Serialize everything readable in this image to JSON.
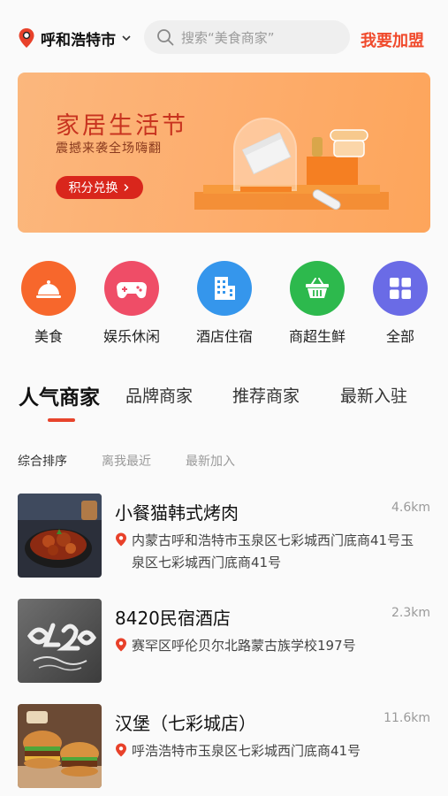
{
  "header": {
    "city": "呼和浩特市",
    "search_placeholder": "搜索“美食商家”",
    "join_label": "我要加盟",
    "icons": {
      "location": "map-pin-icon",
      "dropdown": "chevron-down-icon",
      "search": "search-icon"
    },
    "accent_color": "#f04a2c"
  },
  "banner": {
    "title": "家居生活节",
    "subtitle": "震撼来袭全场嗨翻",
    "button_label": "积分兑换"
  },
  "categories": [
    {
      "label": "美食",
      "icon": "cloche-icon",
      "color": "#f7672c"
    },
    {
      "label": "娱乐休闲",
      "icon": "gamepad-icon",
      "color": "#ef4d67"
    },
    {
      "label": "酒店住宿",
      "icon": "building-icon",
      "color": "#3596ec"
    },
    {
      "label": "商超生鲜",
      "icon": "basket-icon",
      "color": "#2db94d"
    },
    {
      "label": "全部",
      "icon": "grid-icon",
      "color": "#6a6be6"
    }
  ],
  "tabs": [
    {
      "label": "人气商家",
      "active": true
    },
    {
      "label": "品牌商家",
      "active": false
    },
    {
      "label": "推荐商家",
      "active": false
    },
    {
      "label": "最新入驻",
      "active": false
    }
  ],
  "sorts": [
    {
      "label": "综合排序",
      "active": true
    },
    {
      "label": "离我最近",
      "active": false
    },
    {
      "label": "最新加入",
      "active": false
    }
  ],
  "merchants": [
    {
      "name": "小餐猫韩式烤肉",
      "distance": "4.6km",
      "address": "内蒙古呼和浩特市玉泉区七彩城西门底商41号玉泉区七彩城西门底商41号"
    },
    {
      "name": "8420民宿酒店",
      "distance": "2.3km",
      "address": "赛罕区呼伦贝尔北路蒙古族学校197号"
    },
    {
      "name": "汉堡（七彩城店）",
      "distance": "11.6km",
      "address": "呼浩浩特市玉泉区七彩城西门底商41号"
    }
  ]
}
